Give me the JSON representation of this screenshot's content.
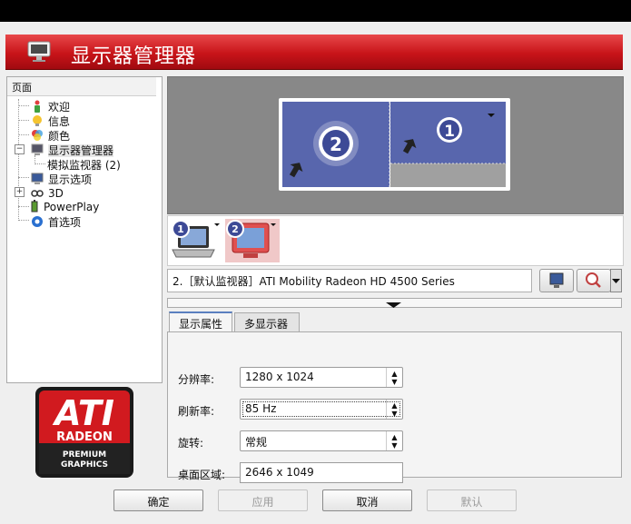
{
  "window": {
    "title": "显示器管理器"
  },
  "tree": {
    "header": "页面",
    "items": [
      {
        "label": "欢迎",
        "icon": "person-icon"
      },
      {
        "label": "信息",
        "icon": "info-bulb-icon"
      },
      {
        "label": "颜色",
        "icon": "color-wheel-icon"
      },
      {
        "label": "显示器管理器",
        "icon": "monitor-icon",
        "selected": true
      },
      {
        "label": "模拟监视器 (2)",
        "icon": ""
      },
      {
        "label": "显示选项",
        "icon": "display-options-icon"
      },
      {
        "label": "3D",
        "icon": "3d-glasses-icon"
      },
      {
        "label": "PowerPlay",
        "icon": "battery-icon"
      },
      {
        "label": "首选项",
        "icon": "preferences-icon"
      }
    ]
  },
  "logo": {
    "brand": "ATI",
    "line1": "RADEON",
    "line2": "PREMIUM",
    "line3": "GRAPHICS"
  },
  "display_layout": {
    "monitor_a_number": "2",
    "monitor_b_number": "1"
  },
  "monitor_strip": {
    "monitor_1_number": "1",
    "monitor_2_number": "2"
  },
  "device_select": {
    "value": "2.［默认监视器］ATI Mobility Radeon HD 4500 Series"
  },
  "tabs": [
    {
      "label": "显示属性",
      "active": true
    },
    {
      "label": "多显示器",
      "active": false
    }
  ],
  "properties": {
    "resolution_label": "分辨率:",
    "resolution_value": "1280 x 1024",
    "refresh_label": "刷新率:",
    "refresh_value": "85 Hz",
    "rotation_label": "旋转:",
    "rotation_value": "常规",
    "desktop_label": "桌面区域:",
    "desktop_value": "2646 x 1049"
  },
  "buttons": {
    "ok": "确定",
    "apply": "应用",
    "cancel": "取消",
    "default": "默认"
  },
  "colors": {
    "title_red": "#c81419",
    "display_bg": "#888888",
    "monitor_blue": "#4a5aa0"
  }
}
